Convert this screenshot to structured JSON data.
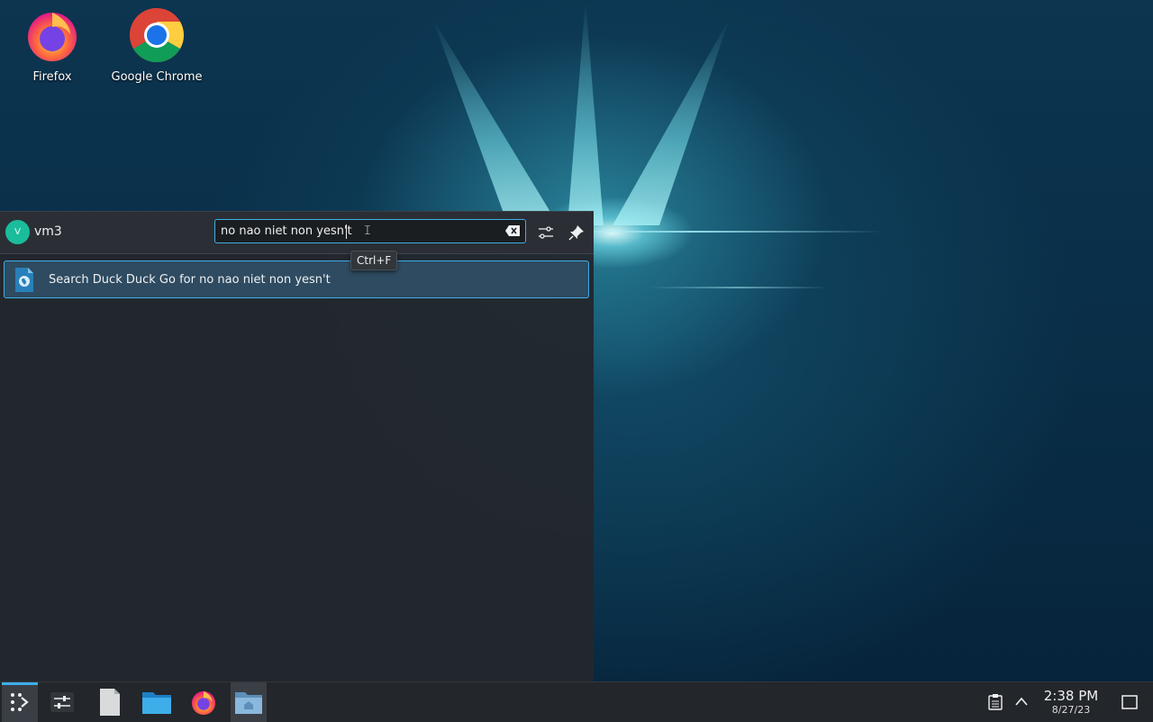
{
  "desktop": {
    "icons": [
      {
        "label": "Firefox",
        "icon": "firefox-icon"
      },
      {
        "label": "Google Chrome",
        "icon": "chrome-icon"
      }
    ]
  },
  "launcher": {
    "user": {
      "avatar_letter": "V",
      "name": "vm3"
    },
    "search": {
      "value": "no nao niet non yesn't",
      "tooltip": "Ctrl+F"
    },
    "results": [
      {
        "label": "Search Duck Duck Go for no nao niet non yesn't",
        "icon": "web-search-icon"
      }
    ],
    "buttons": {
      "configure": "sliders-icon",
      "pin": "pin-icon",
      "clear": "clear-icon"
    }
  },
  "taskbar": {
    "items": [
      {
        "name": "application-launcher",
        "icon": "kde-launcher-icon",
        "active": true
      },
      {
        "name": "system-settings",
        "icon": "sliders-icon",
        "active": false
      },
      {
        "name": "text-editor",
        "icon": "document-icon",
        "active": false
      },
      {
        "name": "file-manager",
        "icon": "folder-icon",
        "active": false
      },
      {
        "name": "firefox",
        "icon": "firefox-icon",
        "active": false
      },
      {
        "name": "home-folder",
        "icon": "home-folder-icon",
        "active": false
      }
    ],
    "tray": {
      "clipboard": "clipboard-icon",
      "expand": "chevron-up-icon",
      "show_desktop": "show-desktop-icon"
    },
    "clock": {
      "time": "2:38 PM",
      "date": "8/27/23"
    }
  },
  "colors": {
    "accent": "#3daee9",
    "panel": "#23262a",
    "launcher_bg": "#2b2f35"
  }
}
